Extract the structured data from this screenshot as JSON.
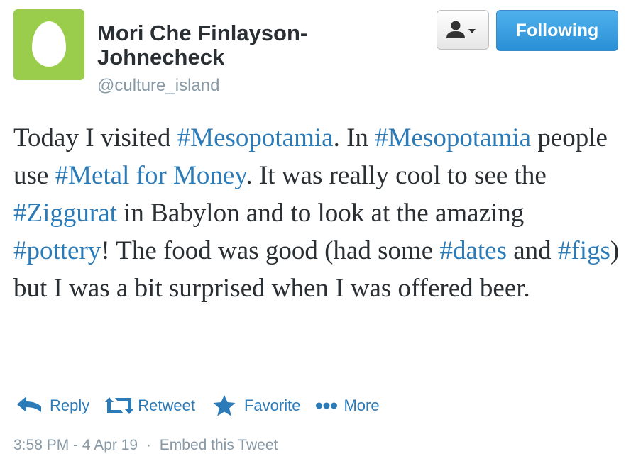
{
  "author": {
    "name": "Mori Che Finlayson-Johnecheck",
    "handle": "@culture_island"
  },
  "header": {
    "follow_label": "Following"
  },
  "tweet": {
    "segments": [
      {
        "text": "Today I visited ",
        "hashtag": false
      },
      {
        "text": "#Mesopotamia",
        "hashtag": true
      },
      {
        "text": ". In ",
        "hashtag": false
      },
      {
        "text": "#Mesopotamia",
        "hashtag": true
      },
      {
        "text": " people use ",
        "hashtag": false
      },
      {
        "text": "#Metal for Money",
        "hashtag": true
      },
      {
        "text": ". It was really cool to see the ",
        "hashtag": false
      },
      {
        "text": "#Ziggurat",
        "hashtag": true
      },
      {
        "text": " in Babylon and to look at the amazing ",
        "hashtag": false
      },
      {
        "text": "#pottery",
        "hashtag": true
      },
      {
        "text": "! The food was good (had some ",
        "hashtag": false
      },
      {
        "text": "#dates",
        "hashtag": true
      },
      {
        "text": " and ",
        "hashtag": false
      },
      {
        "text": "#figs",
        "hashtag": true
      },
      {
        "text": ") but I was a bit surprised when I was offered beer.",
        "hashtag": false
      }
    ]
  },
  "actions": {
    "reply": "Reply",
    "retweet": "Retweet",
    "favorite": "Favorite",
    "more": "More"
  },
  "meta": {
    "timestamp": "3:58 PM - 4 Apr 19",
    "separator": "·",
    "embed": "Embed this Tweet"
  },
  "colors": {
    "avatar_bg": "#9acd4c",
    "link": "#2b7bb9",
    "follow_button": "#2a8fd6",
    "text": "#292f33",
    "muted": "#8899a6"
  },
  "icons": {
    "avatar": "egg-avatar",
    "user_menu": "user-icon",
    "reply": "reply-arrow-icon",
    "retweet": "retweet-icon",
    "favorite": "star-icon",
    "more": "ellipsis-icon"
  }
}
